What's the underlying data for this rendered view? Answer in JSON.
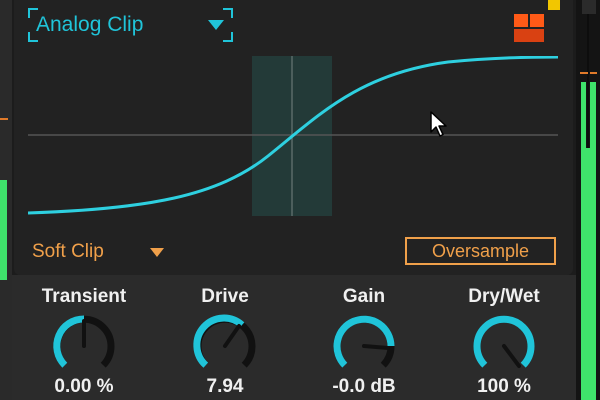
{
  "header": {
    "mode_label": "Analog Clip"
  },
  "clip_type": {
    "label": "Soft Clip"
  },
  "oversample": {
    "label": "Oversample"
  },
  "knobs": [
    {
      "label": "Transient",
      "value": "0.00 %",
      "position": 0.5
    },
    {
      "label": "Drive",
      "value": "7.94",
      "position": 0.62
    },
    {
      "label": "Gain",
      "value": "-0.0 dB",
      "position": 0.75
    },
    {
      "label": "Dry/Wet",
      "value": "100 %",
      "position": 1.0
    }
  ],
  "colors": {
    "accent_cyan": "#20c4d9",
    "accent_orange": "#f0a04a",
    "meter_green": "#3fe36b",
    "device_icon": "#ff5a17",
    "indicator_yellow": "#f2c600",
    "knob_track": "#111111"
  },
  "icons": {
    "device": "device-grid-icon",
    "cursor": "mouse-pointer-icon"
  }
}
